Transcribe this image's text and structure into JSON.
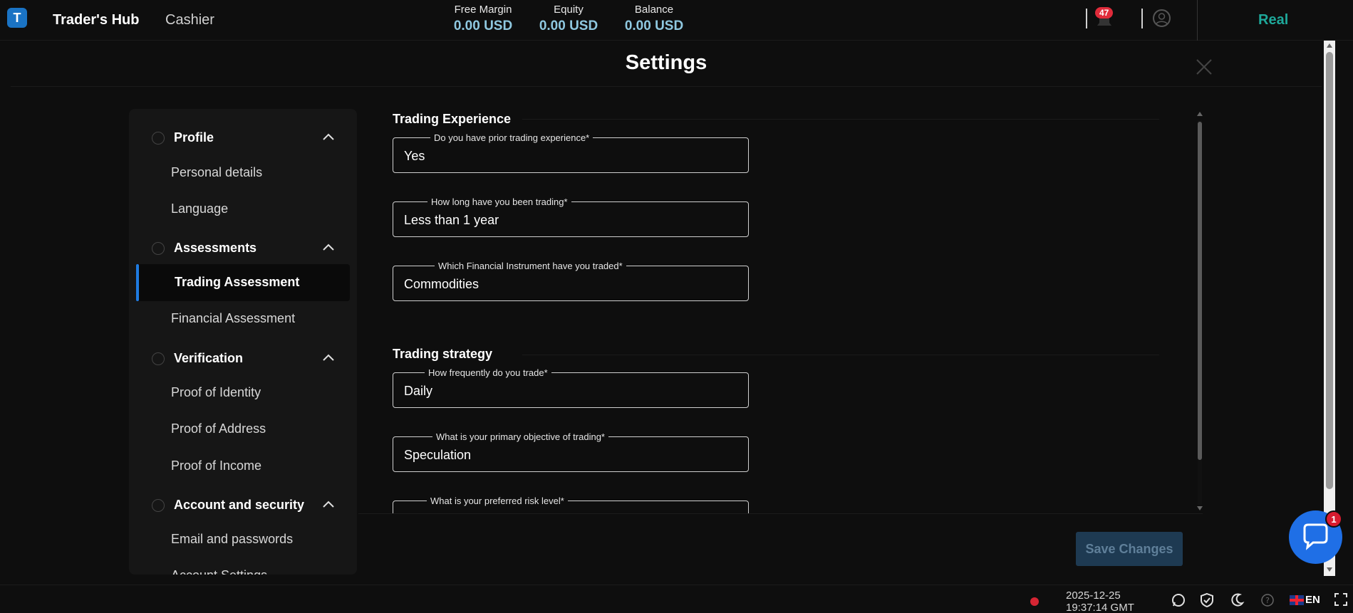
{
  "header": {
    "logo_letter": "T",
    "nav_hub": "Trader's Hub",
    "nav_cashier": "Cashier",
    "metrics": [
      {
        "label": "Free Margin",
        "value": "0.00 USD"
      },
      {
        "label": "Equity",
        "value": "0.00 USD"
      },
      {
        "label": "Balance",
        "value": "0.00 USD"
      }
    ],
    "notification_count": "47",
    "account_type": "Real",
    "icons": {
      "bell": "bell-icon",
      "user": "user-icon"
    }
  },
  "settings": {
    "title": "Settings",
    "close_icon": "close-icon"
  },
  "sidebar": {
    "sections": [
      {
        "label": "Profile",
        "items": [
          "Personal details",
          "Language"
        ]
      },
      {
        "label": "Assessments",
        "items": [
          "Trading Assessment",
          "Financial Assessment"
        ]
      },
      {
        "label": "Verification",
        "items": [
          "Proof of Identity",
          "Proof of Address",
          "Proof of Income"
        ]
      },
      {
        "label": "Account and security",
        "items": [
          "Email and passwords",
          "Account Settings"
        ]
      }
    ],
    "active_item": "Trading Assessment",
    "accent_color": "#1f7be0"
  },
  "form": {
    "trading_experience": {
      "title": "Trading Experience",
      "fields": [
        {
          "label": "Do you have prior trading experience*",
          "value": "Yes"
        },
        {
          "label": "How long have you been trading*",
          "value": "Less than 1 year"
        },
        {
          "label": "Which Financial Instrument have you traded*",
          "value": "Commodities"
        }
      ]
    },
    "trading_strategy": {
      "title": "Trading strategy",
      "fields": [
        {
          "label": "How frequently do you trade*",
          "value": "Daily"
        },
        {
          "label": "What is your primary objective of trading*",
          "value": "Speculation"
        },
        {
          "label": "What is your preferred risk level*",
          "value": ""
        }
      ]
    },
    "save_label": "Save Changes"
  },
  "chat": {
    "badge": "1",
    "icon": "chat-bubble-icon"
  },
  "footer": {
    "date": "2025-12-25",
    "time": "19:37:14 GMT",
    "language": "EN",
    "icons": [
      "whatsapp-icon",
      "shield-check-icon",
      "moon-icon",
      "help-icon",
      "fullscreen-icon"
    ]
  },
  "colors": {
    "background": "#0e0e0e",
    "panel": "#161616",
    "metric_value": "#8fc8e0",
    "real": "#1ea89a",
    "notification": "#e02b3a",
    "save_button": "#1e3a52"
  }
}
